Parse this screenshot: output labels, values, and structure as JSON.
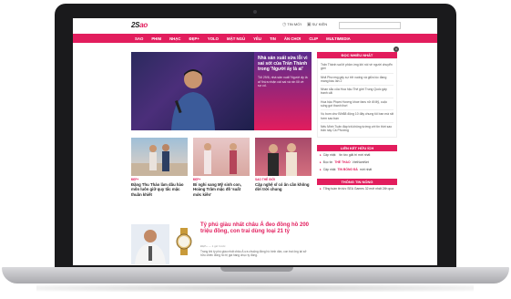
{
  "site": {
    "logo_main": "2S",
    "logo_accent": "ao",
    "top_links": [
      {
        "icon": "clock-icon",
        "glyph": "◷",
        "label": "TIN MỚI"
      },
      {
        "icon": "calendar-icon",
        "glyph": "▣",
        "label": "SỰ KIỆN"
      }
    ],
    "nav": [
      "SAO",
      "PHIM",
      "NHẠC",
      "ĐẸP+",
      "YOLO",
      "MẶT NGỦ",
      "YÊU",
      "TIN",
      "ĂN CHƠI",
      "CLIP",
      "MULTIMEDIA"
    ]
  },
  "hero": {
    "title": "Nhà sản xuất sửa lỗi vì sai sót của Trấn Thành trong 'Người ấy là ai'",
    "desc": "Tối 29/6, nhà sản xuất 'Người ấy là ai' thừa nhận cái sai và xin lỗi về sự cố."
  },
  "thumbs": [
    {
      "cat": "ĐẸP+",
      "title": "Đặng Thu Thảo làm dâu hào môn luôn giữ quy tắc mặc thuần khiết"
    },
    {
      "cat": "ĐẸP+",
      "title": "Bí nghi sang Mỹ sinh con, Hoàng Trâm mặc đồ 'suất mức kiền'"
    },
    {
      "cat": "SAO THẾ GIỚI",
      "title": "Cặp nghệ sĩ có ân cần không dời trời chung"
    }
  ],
  "article": {
    "title": "Tỷ phú giàu nhất châu Á đeo đồng hồ 200 triệu đồng, con trai dùng loại 21 tỷ",
    "meta": "ĐẸP+ — 1 giờ trước",
    "desc": "Trong khi tỷ phú giàu nhất châu Á ưa chuộng đồng hồ bình dân, con trai ông lại sở hữu chiếc đồng hồ trị giá hàng chục tỷ đồng."
  },
  "sidebar": {
    "head1": "ĐỌC NHIỀU NHẤT",
    "most_read": [
      "Trấn Thành sai lệ phản ứng khi nói về người chuyển giới",
      "Nhã Phương gây sự trở xuống và giữa lúc đang mang bầu lần 2",
      "Nhan sắc của Hoa hậu Thế giới Trung Quốc gây tranh cãi",
      "Hoa hậu Phạm Hương khoe fans nữ đi Mỹ, cuộc sống gợi thanh thơi",
      "Vụ bom chư Bởi88 động 10 đây chung tôi ban mà rất hơm sao bạn",
      "Nếu Minh Tuấn đáp trả không tường với tin thời sao trấn nay Cá Phương"
    ],
    "head2": "LIÊN KẾT HỮU ÍCH",
    "links": [
      {
        "pre": "Cập nhật",
        "hl": "",
        "post": "tin tức giải trí mới nhất"
      },
      {
        "pre": "Đọc tin",
        "hl": "THỂ THAO",
        "post": "VietNamNet"
      },
      {
        "pre": "Cập nhật",
        "hl": "TIN BÓNG ĐÁ",
        "post": "mới nhất"
      }
    ],
    "head3": "THÔNG TIN NÓNG",
    "hot": [
      "Tổng tuần tin tức SEA Games 32 mới nhất 24h qua"
    ]
  },
  "colors": {
    "accent": "#e21d5d",
    "laptop": "#1a1a1c"
  }
}
